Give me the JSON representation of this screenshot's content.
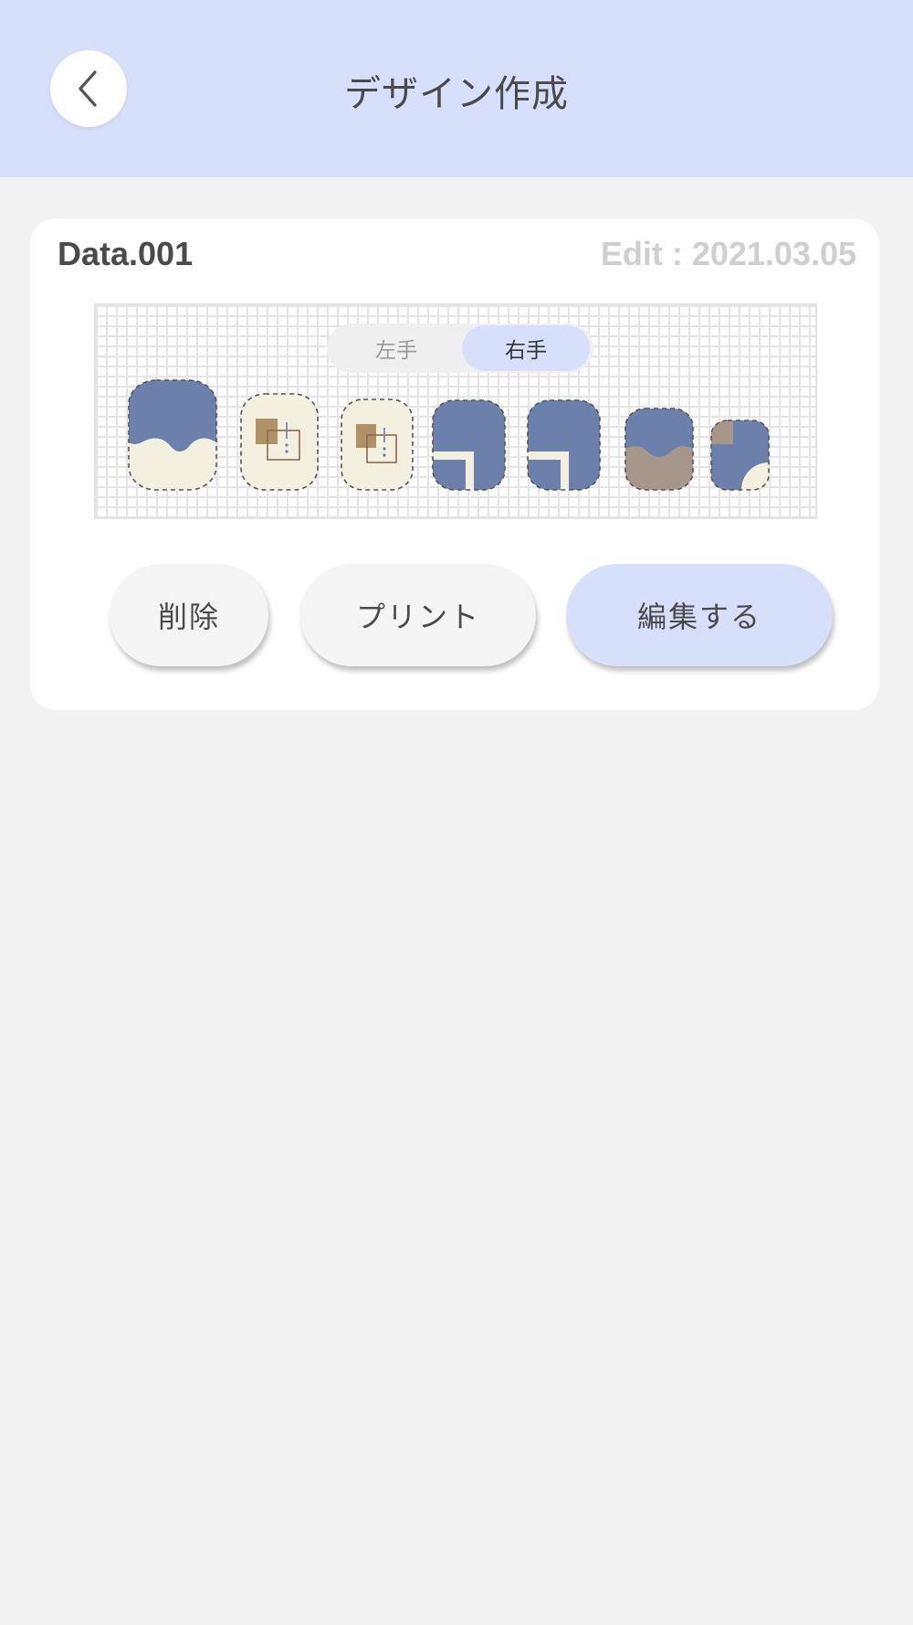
{
  "header": {
    "title": "デザイン作成",
    "back_icon": "chevron-left-icon"
  },
  "card": {
    "title": "Data.001",
    "edit_date": "Edit : 2021.03.05"
  },
  "hand_toggle": {
    "left_label": "左手",
    "right_label": "右手",
    "selected": "右手"
  },
  "actions": {
    "delete_label": "削除",
    "print_label": "プリント",
    "edit_label": "編集する"
  },
  "colors": {
    "header_bg": "#d7e0fb",
    "page_bg": "#f2f2f2",
    "nail_blue": "#6b80aa",
    "nail_cream": "#f3f0df",
    "nail_brown": "#b09066",
    "nail_taupe": "#a7968a"
  }
}
